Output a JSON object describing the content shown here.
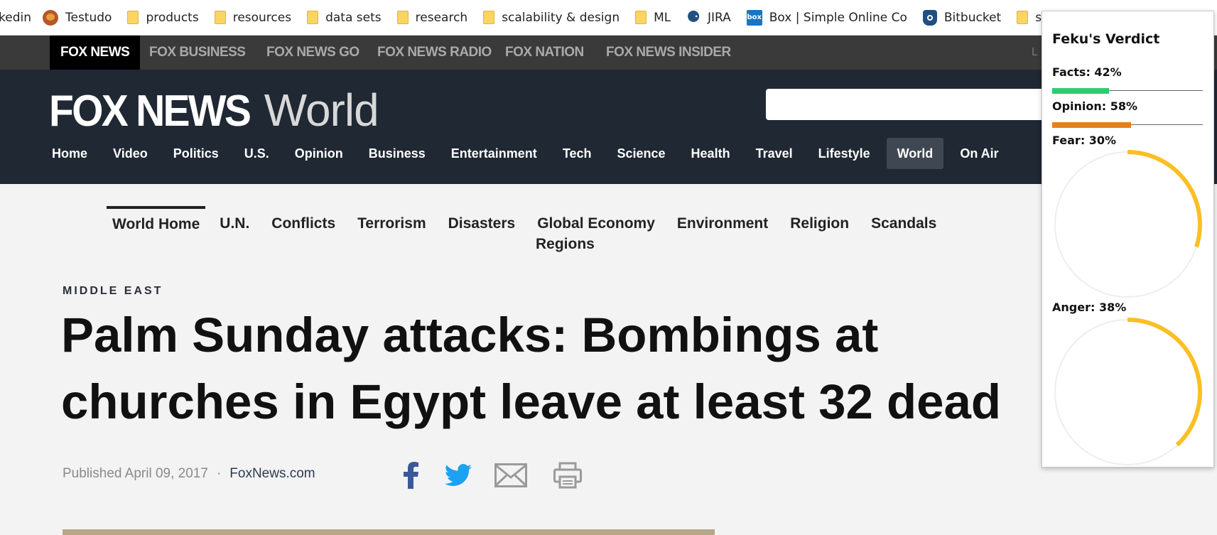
{
  "bookmarks": [
    {
      "label": "kedin",
      "icon": "none"
    },
    {
      "label": "Testudo",
      "icon": "tortoise-icon"
    },
    {
      "label": "products",
      "icon": "folder-icon"
    },
    {
      "label": "resources",
      "icon": "folder-icon"
    },
    {
      "label": "data sets",
      "icon": "folder-icon"
    },
    {
      "label": "research",
      "icon": "folder-icon"
    },
    {
      "label": "scalability & design",
      "icon": "folder-icon"
    },
    {
      "label": "ML",
      "icon": "folder-icon"
    },
    {
      "label": "JIRA",
      "icon": "jira-icon"
    },
    {
      "label": "Box | Simple Online Co",
      "icon": "box-icon"
    },
    {
      "label": "Bitbucket",
      "icon": "bitbucket-icon"
    },
    {
      "label": "slack",
      "icon": "folder-icon"
    }
  ],
  "network": {
    "items": [
      "FOX NEWS",
      "FOX BUSINESS",
      "FOX NEWS GO",
      "FOX NEWS RADIO",
      "FOX NATION",
      "FOX NEWS INSIDER"
    ],
    "extra": "L"
  },
  "header": {
    "logo_main": "FOX NEWS",
    "logo_sub": "World",
    "search_placeholder": "",
    "nav": [
      "Home",
      "Video",
      "Politics",
      "U.S.",
      "Opinion",
      "Business",
      "Entertainment",
      "Tech",
      "Science",
      "Health",
      "Travel",
      "Lifestyle",
      "World",
      "On Air"
    ],
    "nav_active": "World"
  },
  "subnav": {
    "items": [
      "World Home",
      "U.N.",
      "Conflicts",
      "Terrorism",
      "Disasters",
      "Global Economy",
      "Environment",
      "Religion",
      "Scandals"
    ],
    "regions": "Regions"
  },
  "article": {
    "eyebrow": "MIDDLE EAST",
    "headline": "Palm Sunday attacks: Bombings at churches in Egypt leave at least 32 dead",
    "published": "Published April 09, 2017",
    "dot": "·",
    "source": "FoxNews.com"
  },
  "verdict": {
    "title": "Feku's Verdict",
    "facts_label": "Facts: 42%",
    "facts": 0.42,
    "opinion_label": "Opinion: 58%",
    "opinion": 0.58,
    "fear_label": "Fear: 30%",
    "fear": 0.3,
    "anger_label": "Anger: 38%",
    "anger": 0.38,
    "colors": {
      "facts": "#2ecc71",
      "opinion": "#e67e22",
      "gauge": "#fbbf24",
      "gauge_track": "#eeeeee"
    }
  },
  "colors": {
    "header_bg": "#1f2833",
    "network_bg": "#3a3a3a",
    "page_bg": "#f3f3f3",
    "facebook": "#3b5998",
    "twitter": "#1da1f2",
    "share_gray": "#9a9a9a"
  }
}
